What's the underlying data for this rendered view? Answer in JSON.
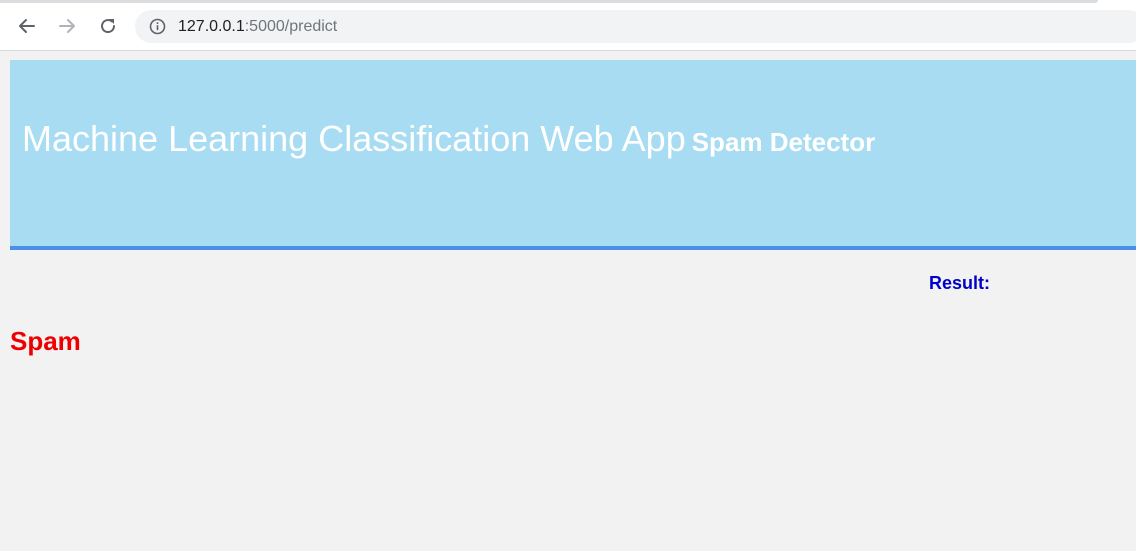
{
  "browser": {
    "url_host": "127.0.0.1",
    "url_path": ":5000/predict",
    "icons": {
      "back": "arrow-left-icon",
      "forward": "arrow-right-icon",
      "reload": "reload-icon",
      "info": "info-icon"
    }
  },
  "header": {
    "title": "Machine Learning Classification Web App",
    "subtitle": "Spam Detector",
    "background_color": "#a8dcf3",
    "border_color": "#4a8ee8"
  },
  "result": {
    "label": "Result:",
    "label_color": "#0000cc",
    "prediction": "Spam",
    "prediction_color": "#ee0000"
  }
}
